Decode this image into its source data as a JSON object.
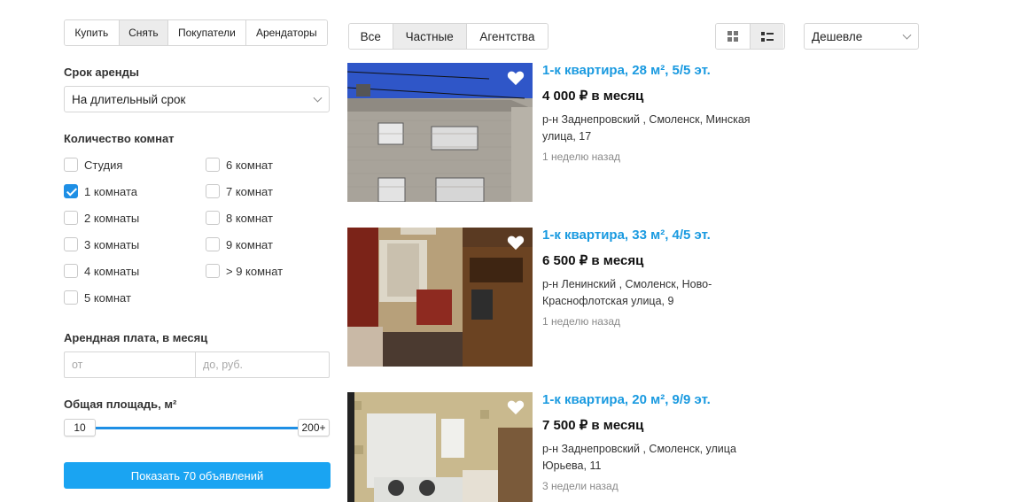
{
  "deal_tabs": [
    "Купить",
    "Снять",
    "Покупатели",
    "Арендаторы"
  ],
  "deal_tabs_active": 1,
  "rent_term": {
    "label": "Срок аренды",
    "value": "На длительный срок"
  },
  "rooms": {
    "label": "Количество комнат",
    "options": [
      {
        "label": "Студия",
        "checked": false
      },
      {
        "label": "1 комната",
        "checked": true
      },
      {
        "label": "2 комнаты",
        "checked": false
      },
      {
        "label": "3 комнаты",
        "checked": false
      },
      {
        "label": "4 комнаты",
        "checked": false
      },
      {
        "label": "5 комнат",
        "checked": false
      },
      {
        "label": "6 комнат",
        "checked": false
      },
      {
        "label": "7 комнат",
        "checked": false
      },
      {
        "label": "8 комнат",
        "checked": false
      },
      {
        "label": "9 комнат",
        "checked": false
      },
      {
        "label": "> 9 комнат",
        "checked": false
      }
    ]
  },
  "price": {
    "label": "Арендная плата, в месяц",
    "from_placeholder": "от",
    "to_placeholder": "до, руб."
  },
  "area": {
    "label": "Общая площадь, м²",
    "min": "10",
    "max": "200+"
  },
  "show_button": "Показать 70 объявлений",
  "seller_tabs": [
    "Все",
    "Частные",
    "Агентства"
  ],
  "seller_tabs_active": 1,
  "sort": {
    "value": "Дешевле"
  },
  "colors": {
    "accent": "#1aa4f2",
    "link": "#1a9ae0",
    "check": "#1e8fe5"
  },
  "listings": [
    {
      "title": "1-к квартира, 28 м², 5/5 эт.",
      "price": "4 000 ₽ в месяц",
      "address": "р-н Заднепровский , Смоленск, Минская улица, 17",
      "date": "1 неделю назад"
    },
    {
      "title": "1-к квартира, 33 м², 4/5 эт.",
      "price": "6 500 ₽ в месяц",
      "address": "р-н Ленинский , Смоленск, Ново-Краснофлотская улица, 9",
      "date": "1 неделю назад"
    },
    {
      "title": "1-к квартира, 20 м², 9/9 эт.",
      "price": "7 500 ₽ в месяц",
      "address": "р-н Заднепровский , Смоленск, улица Юрьева, 11",
      "date": "3 недели назад"
    }
  ]
}
